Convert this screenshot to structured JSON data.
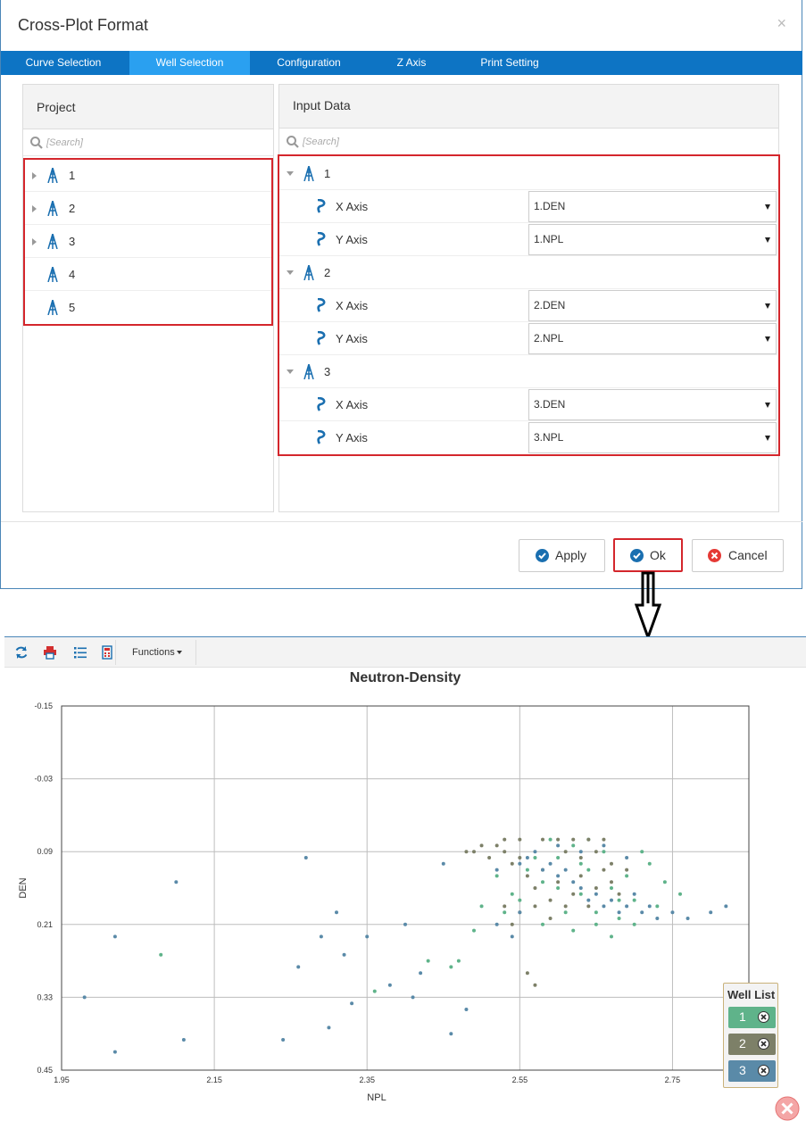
{
  "dialog": {
    "title": "Cross-Plot Format",
    "close_glyph": "×",
    "tabs": [
      {
        "label": "Curve Selection",
        "active": false
      },
      {
        "label": "Well Selection",
        "active": true
      },
      {
        "label": "Configuration",
        "active": false
      },
      {
        "label": "Z Axis",
        "active": false
      },
      {
        "label": "Print Setting",
        "active": false
      }
    ],
    "project_panel": {
      "title": "Project",
      "search_placeholder": "[Search]",
      "wells": [
        {
          "label": "1",
          "expandable": true,
          "icon": "oil-rig-icon"
        },
        {
          "label": "2",
          "expandable": true,
          "icon": "oil-rig-icon"
        },
        {
          "label": "3",
          "expandable": true,
          "icon": "oil-rig-icon"
        },
        {
          "label": "4",
          "expandable": false,
          "icon": "oil-rig-icon"
        },
        {
          "label": "5",
          "expandable": false,
          "icon": "oil-rig-icon"
        }
      ]
    },
    "input_panel": {
      "title": "Input Data",
      "search_placeholder": "[Search]",
      "wells": [
        {
          "label": "1",
          "x_label": "X Axis",
          "x_value": "1.DEN",
          "y_label": "Y Axis",
          "y_value": "1.NPL"
        },
        {
          "label": "2",
          "x_label": "X Axis",
          "x_value": "2.DEN",
          "y_label": "Y Axis",
          "y_value": "2.NPL"
        },
        {
          "label": "3",
          "x_label": "X Axis",
          "x_value": "3.DEN",
          "y_label": "Y Axis",
          "y_value": "3.NPL"
        }
      ]
    },
    "buttons": {
      "apply": "Apply",
      "ok": "Ok",
      "cancel": "Cancel"
    },
    "colors": {
      "tabbar": "#0d74c4",
      "tab_active": "#2aa0f0",
      "highlight": "#d4262c",
      "icon_blue": "#1a6fb0"
    }
  },
  "chart_window": {
    "toolbar": {
      "icons": [
        "refresh-icon",
        "print-icon",
        "list-icon",
        "calculator-icon"
      ],
      "functions_label": "Functions"
    },
    "chart_data": {
      "type": "scatter",
      "title": "Neutron-Density",
      "xlabel": "NPL",
      "ylabel": "DEN",
      "xlim": [
        1.95,
        2.85
      ],
      "ylim": [
        -0.15,
        0.45
      ],
      "y_inverted": true,
      "x_ticks": [
        "1.95",
        "2.15",
        "2.35",
        "2.55",
        "2.75"
      ],
      "y_ticks": [
        "-0.15",
        "-0.03",
        "0.09",
        "0.21",
        "0.33",
        "0.45"
      ],
      "grid": true,
      "series": [
        {
          "name": "1",
          "color": "#5fb38a",
          "points": [
            [
              2.08,
              0.26
            ],
            [
              2.36,
              0.32
            ],
            [
              2.43,
              0.27
            ],
            [
              2.46,
              0.28
            ],
            [
              2.5,
              0.18
            ],
            [
              2.52,
              0.13
            ],
            [
              2.54,
              0.16
            ],
            [
              2.56,
              0.12
            ],
            [
              2.58,
              0.14
            ],
            [
              2.6,
              0.1
            ],
            [
              2.62,
              0.08
            ],
            [
              2.63,
              0.16
            ],
            [
              2.64,
              0.12
            ],
            [
              2.65,
              0.19
            ],
            [
              2.66,
              0.09
            ],
            [
              2.67,
              0.15
            ],
            [
              2.68,
              0.2
            ],
            [
              2.69,
              0.13
            ],
            [
              2.7,
              0.17
            ],
            [
              2.72,
              0.11
            ],
            [
              2.73,
              0.18
            ],
            [
              2.74,
              0.14
            ],
            [
              2.58,
              0.21
            ],
            [
              2.61,
              0.19
            ],
            [
              2.65,
              0.21
            ],
            [
              2.7,
              0.21
            ],
            [
              2.55,
              0.17
            ],
            [
              2.53,
              0.19
            ],
            [
              2.59,
              0.07
            ],
            [
              2.64,
              0.07
            ],
            [
              2.71,
              0.09
            ],
            [
              2.76,
              0.16
            ],
            [
              2.49,
              0.22
            ],
            [
              2.47,
              0.27
            ],
            [
              2.62,
              0.22
            ],
            [
              2.67,
              0.23
            ],
            [
              2.57,
              0.1
            ],
            [
              2.6,
              0.15
            ],
            [
              2.63,
              0.11
            ],
            [
              2.68,
              0.17
            ]
          ]
        },
        {
          "name": "2",
          "color": "#7d8068",
          "points": [
            [
              2.49,
              0.09
            ],
            [
              2.51,
              0.1
            ],
            [
              2.52,
              0.08
            ],
            [
              2.53,
              0.09
            ],
            [
              2.54,
              0.11
            ],
            [
              2.55,
              0.1
            ],
            [
              2.56,
              0.13
            ],
            [
              2.57,
              0.15
            ],
            [
              2.58,
              0.12
            ],
            [
              2.59,
              0.17
            ],
            [
              2.6,
              0.14
            ],
            [
              2.61,
              0.09
            ],
            [
              2.62,
              0.16
            ],
            [
              2.63,
              0.13
            ],
            [
              2.64,
              0.18
            ],
            [
              2.65,
              0.15
            ],
            [
              2.66,
              0.12
            ],
            [
              2.67,
              0.14
            ],
            [
              2.68,
              0.16
            ],
            [
              2.58,
              0.07
            ],
            [
              2.6,
              0.07
            ],
            [
              2.62,
              0.07
            ],
            [
              2.64,
              0.07
            ],
            [
              2.66,
              0.07
            ],
            [
              2.53,
              0.07
            ],
            [
              2.55,
              0.19
            ],
            [
              2.57,
              0.18
            ],
            [
              2.59,
              0.2
            ],
            [
              2.61,
              0.18
            ],
            [
              2.56,
              0.29
            ],
            [
              2.57,
              0.31
            ],
            [
              2.53,
              0.18
            ],
            [
              2.54,
              0.21
            ],
            [
              2.5,
              0.08
            ],
            [
              2.48,
              0.09
            ],
            [
              2.55,
              0.07
            ],
            [
              2.63,
              0.1
            ],
            [
              2.65,
              0.09
            ],
            [
              2.67,
              0.11
            ],
            [
              2.69,
              0.12
            ]
          ]
        },
        {
          "name": "3",
          "color": "#5a8aa8",
          "points": [
            [
              1.98,
              0.33
            ],
            [
              2.02,
              0.42
            ],
            [
              2.02,
              0.23
            ],
            [
              2.11,
              0.4
            ],
            [
              2.1,
              0.14
            ],
            [
              2.24,
              0.4
            ],
            [
              2.27,
              0.1
            ],
            [
              2.29,
              0.23
            ],
            [
              2.3,
              0.38
            ],
            [
              2.31,
              0.19
            ],
            [
              2.33,
              0.34
            ],
            [
              2.35,
              0.23
            ],
            [
              2.4,
              0.21
            ],
            [
              2.41,
              0.33
            ],
            [
              2.45,
              0.11
            ],
            [
              2.46,
              0.39
            ],
            [
              2.48,
              0.35
            ],
            [
              2.52,
              0.21
            ],
            [
              2.54,
              0.23
            ],
            [
              2.55,
              0.19
            ],
            [
              2.56,
              0.1
            ],
            [
              2.57,
              0.09
            ],
            [
              2.58,
              0.12
            ],
            [
              2.59,
              0.11
            ],
            [
              2.6,
              0.13
            ],
            [
              2.61,
              0.12
            ],
            [
              2.62,
              0.14
            ],
            [
              2.63,
              0.15
            ],
            [
              2.64,
              0.17
            ],
            [
              2.65,
              0.16
            ],
            [
              2.66,
              0.18
            ],
            [
              2.67,
              0.17
            ],
            [
              2.68,
              0.19
            ],
            [
              2.69,
              0.18
            ],
            [
              2.7,
              0.16
            ],
            [
              2.71,
              0.19
            ],
            [
              2.72,
              0.18
            ],
            [
              2.73,
              0.2
            ],
            [
              2.75,
              0.19
            ],
            [
              2.77,
              0.2
            ],
            [
              2.8,
              0.19
            ],
            [
              2.82,
              0.18
            ],
            [
              2.6,
              0.08
            ],
            [
              2.63,
              0.09
            ],
            [
              2.66,
              0.08
            ],
            [
              2.69,
              0.1
            ],
            [
              2.55,
              0.11
            ],
            [
              2.52,
              0.12
            ],
            [
              2.42,
              0.29
            ],
            [
              2.38,
              0.31
            ],
            [
              2.32,
              0.26
            ],
            [
              2.26,
              0.28
            ]
          ]
        }
      ]
    },
    "well_list": {
      "title": "Well List",
      "items": [
        {
          "label": "1",
          "color": "#5fb38a"
        },
        {
          "label": "2",
          "color": "#7d8068"
        },
        {
          "label": "3",
          "color": "#5a8aa8"
        }
      ]
    }
  }
}
